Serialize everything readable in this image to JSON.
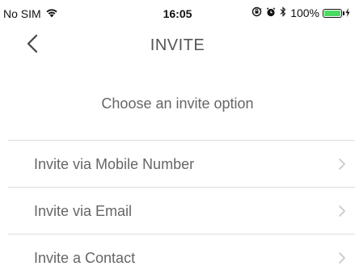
{
  "status_bar": {
    "carrier": "No SIM",
    "time": "16:05",
    "battery_percent": "100%",
    "battery_level": 1.0,
    "battery_color": "#4cd964",
    "icons": [
      "wifi-icon",
      "screen-rotation-lock-icon",
      "alarm-icon",
      "bluetooth-icon",
      "battery-icon",
      "charging-icon"
    ]
  },
  "nav": {
    "title": "INVITE",
    "back_icon": "chevron-left-icon"
  },
  "prompt": "Choose an invite option",
  "options": [
    {
      "label": "Invite via Mobile Number",
      "icon": "chevron-right-icon"
    },
    {
      "label": "Invite via Email",
      "icon": "chevron-right-icon"
    },
    {
      "label": "Invite a Contact",
      "icon": "chevron-right-icon"
    }
  ],
  "colors": {
    "text_secondary": "#666666",
    "title": "#555555",
    "divider": "#dcdcdc",
    "chevron": "#c7c7cc"
  }
}
